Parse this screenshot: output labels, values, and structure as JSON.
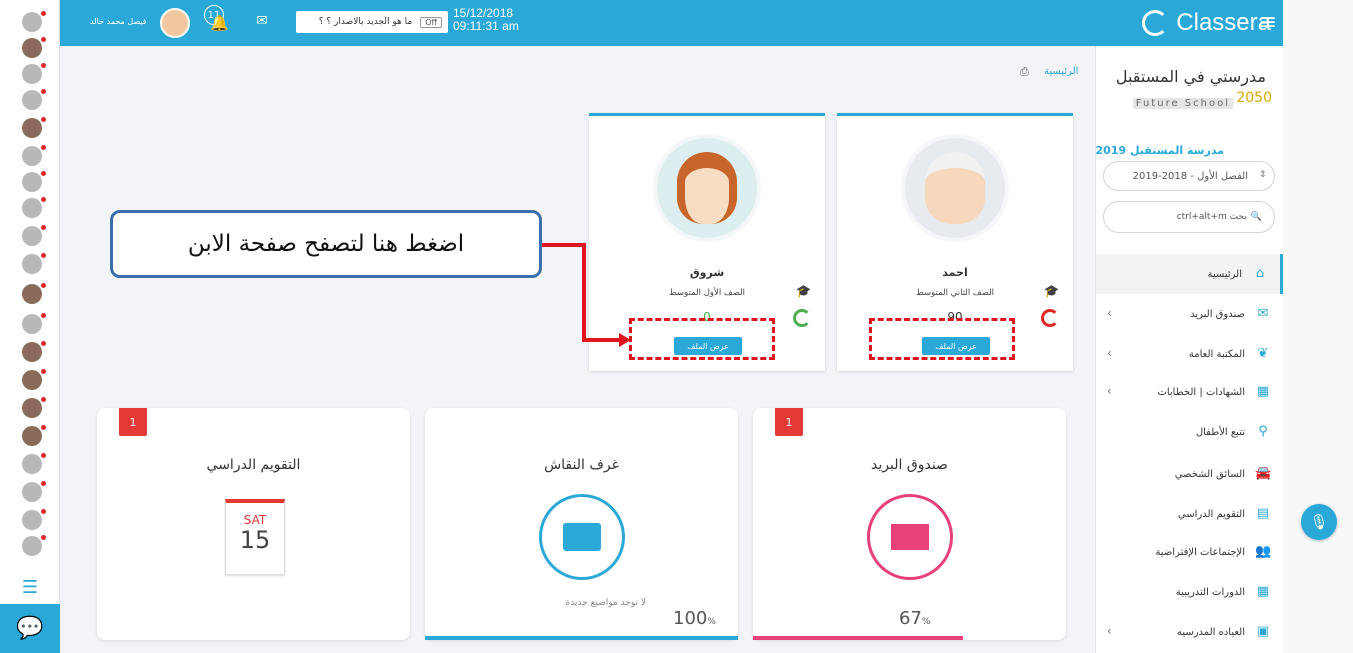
{
  "topbar": {
    "brand": "Classera",
    "datetime_date": "15/12/2018",
    "datetime_time": "09:11:31 am",
    "news_text": "ما هو الجديد بالاصدار ؟ ؟",
    "news_tag": "Off",
    "notification_count": "11",
    "user_name": "فيصل محمد خالد",
    "color": "#2aa8d8"
  },
  "sidebar": {
    "school_title": "مدرستي في المستقبل",
    "school_subtitle": "Future School",
    "school_year_label": "2050",
    "school_name": "مدرسة المستقبل 2019",
    "term_select": "الفصل الأول - 2018-2019",
    "search_placeholder": "ctrl+alt+m  بحث",
    "items": [
      {
        "label": "الرئيسية",
        "icon": "home-icon"
      },
      {
        "label": "صندوق البريد",
        "icon": "mail-icon"
      },
      {
        "label": "المكتبة العامة",
        "icon": "leaf-icon"
      },
      {
        "label": "الشهادات | الخطابات",
        "icon": "qr-icon"
      },
      {
        "label": "تتبع الأطفال",
        "icon": "location-pin-icon"
      },
      {
        "label": "السائق الشخصي",
        "icon": "car-icon"
      },
      {
        "label": "التقويم الدراسي",
        "icon": "calendar-icon"
      },
      {
        "label": "الإجتماعات الإفتراضية",
        "icon": "group-icon"
      },
      {
        "label": "الدورات التدريبية",
        "icon": "grid-icon"
      },
      {
        "label": "العياده المدرسيه",
        "icon": "clinic-icon"
      }
    ]
  },
  "breadcrumb": {
    "home": "الرئيسية"
  },
  "children": [
    {
      "name": "احمد",
      "grade": "الصف الثاني المتوسط",
      "score": "90",
      "button": "عرض الملف",
      "logo_color": "#e02828"
    },
    {
      "name": "شروق",
      "grade": "الصف الأول المتوسط",
      "score": "0",
      "button": "عرض الملف",
      "logo_color": "#4caf50"
    }
  ],
  "callout": {
    "text": "اضغط هنا لتصفح صفحة الابن"
  },
  "widgets": {
    "mail": {
      "title": "صندوق البريد",
      "badge": "1",
      "percent": "67",
      "percent_unit": "%",
      "progress": 0.67,
      "color": "#e8417a"
    },
    "discussion": {
      "title": "غرف النقاش",
      "percent": "100",
      "percent_unit": "%",
      "empty_text": "لا توجد مواضيع جديدة",
      "progress": 1.0,
      "color": "#2aa8d8"
    },
    "calendar": {
      "title": "التقويم الدراسي",
      "badge": "1",
      "day": "SAT",
      "date": "15"
    }
  }
}
